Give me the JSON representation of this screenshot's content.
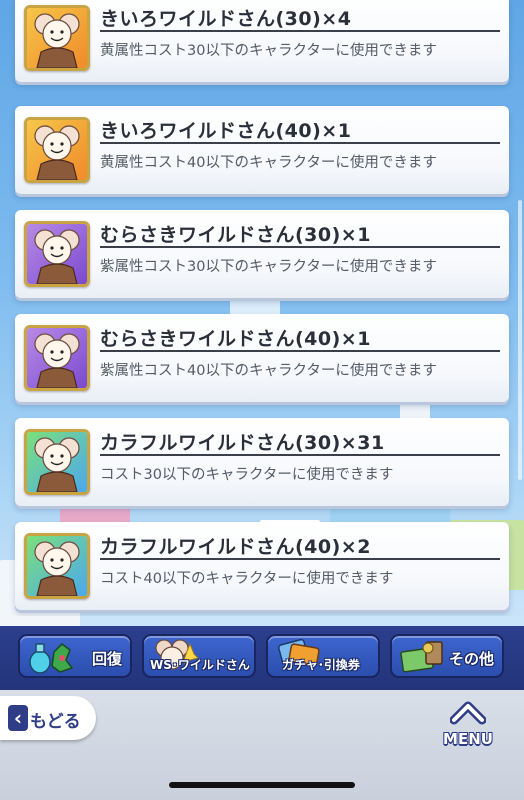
{
  "items": [
    {
      "title": "きいろワイルドさん(30)×4",
      "desc": "黄属性コスト30以下のキャラクターに使用できます",
      "bg1": "#f6c64a",
      "bg2": "#f08a2a"
    },
    {
      "title": "きいろワイルドさん(40)×1",
      "desc": "黄属性コスト40以下のキャラクターに使用できます",
      "bg1": "#f6c64a",
      "bg2": "#f08a2a"
    },
    {
      "title": "むらさきワイルドさん(30)×1",
      "desc": "紫属性コスト30以下のキャラクターに使用できます",
      "bg1": "#b88ae6",
      "bg2": "#7a4ad0"
    },
    {
      "title": "むらさきワイルドさん(40)×1",
      "desc": "紫属性コスト40以下のキャラクターに使用できます",
      "bg1": "#b88ae6",
      "bg2": "#7a4ad0"
    },
    {
      "title": "カラフルワイルドさん(30)×31",
      "desc": "コスト30以下のキャラクターに使用できます",
      "bg1": "#7be07a",
      "bg2": "#4aa8f0"
    },
    {
      "title": "カラフルワイルドさん(40)×2",
      "desc": "コスト40以下のキャラクターに使用できます",
      "bg1": "#7be07a",
      "bg2": "#4aa8f0"
    }
  ],
  "tabs": [
    {
      "label": "回復",
      "icon": "potion-herb-icon"
    },
    {
      "label": "WS･ワイルドさん",
      "icon": "wild-character-icon"
    },
    {
      "label": "ガチャ･引換券",
      "icon": "ticket-icon"
    },
    {
      "label": "その他",
      "icon": "misc-items-icon"
    }
  ],
  "footer": {
    "back_label": "もどる",
    "menu_label": "MENU"
  }
}
